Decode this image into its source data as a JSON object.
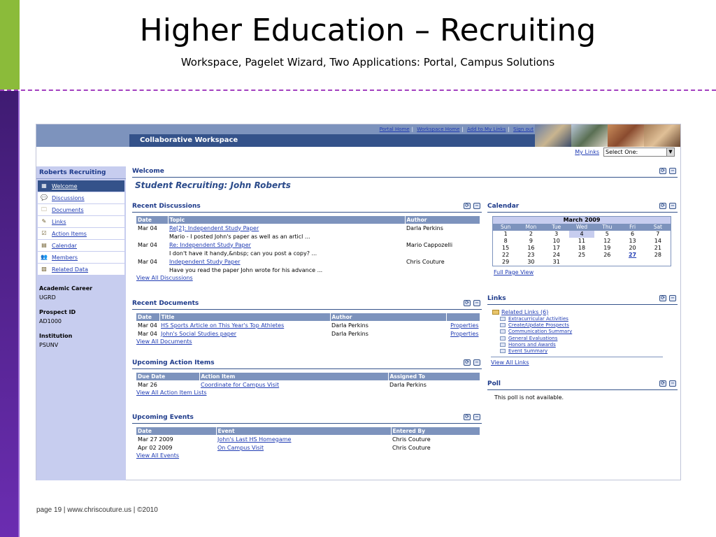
{
  "slide": {
    "title": "Higher Education – Recruiting",
    "subtitle": "Workspace, Pagelet Wizard, Two Applications: Portal, Campus Solutions",
    "footer": "page 19 | www.chriscouture.us | ©2010"
  },
  "app": {
    "top_links": [
      "Portal Home",
      "Workspace Home",
      "Add to My Links",
      "Sign out"
    ],
    "banner_title": "Collaborative Workspace",
    "my_links_label": "My Links",
    "select_value": "Select One:",
    "sidebar": {
      "title": "Roberts Recruiting",
      "items": [
        {
          "label": "Welcome",
          "icon": "grid-icon",
          "glyph": "▦"
        },
        {
          "label": "Discussions",
          "icon": "speech-bubble-icon",
          "glyph": "💬"
        },
        {
          "label": "Documents",
          "icon": "folder-docs-icon",
          "glyph": "🗀"
        },
        {
          "label": "Links",
          "icon": "link-icon",
          "glyph": "✎"
        },
        {
          "label": "Action Items",
          "icon": "checklist-icon",
          "glyph": "☑"
        },
        {
          "label": "Calendar",
          "icon": "calendar-icon",
          "glyph": "▤"
        },
        {
          "label": "Members",
          "icon": "members-icon",
          "glyph": "👥"
        },
        {
          "label": "Related Data",
          "icon": "related-data-icon",
          "glyph": "▧"
        }
      ],
      "info": [
        {
          "label": "Academic Career",
          "value": "UGRD"
        },
        {
          "label": "Prospect ID",
          "value": "AD1000"
        },
        {
          "label": "Institution",
          "value": "PSUNV"
        }
      ]
    },
    "welcome": {
      "header": "Welcome",
      "student_title": "Student Recruiting: John Roberts"
    },
    "discussions": {
      "header": "Recent Discussions",
      "columns": [
        "Date",
        "Topic",
        "Author"
      ],
      "rows": [
        {
          "date": "Mar 04",
          "topic": "Re[2]: Independent Study Paper",
          "preview": "Mario - I posted John's paper as well as an articl ...",
          "author": "Darla Perkins"
        },
        {
          "date": "Mar 04",
          "topic": "Re: Independent Study Paper",
          "preview": "I don't have it handy,&nbsp; can you post a copy? ...",
          "author": "Mario Cappozelli"
        },
        {
          "date": "Mar 04",
          "topic": "Independent Study Paper",
          "preview": "Have you read the paper John wrote for his advance ...",
          "author": "Chris Couture"
        }
      ],
      "view_all": "View All Discussions"
    },
    "documents": {
      "header": "Recent Documents",
      "columns": [
        "Date",
        "Title",
        "Author",
        ""
      ],
      "rows": [
        {
          "date": "Mar 04",
          "title": "HS Sports Article on This Year's Top Athletes",
          "author": "Darla Perkins",
          "action": "Properties"
        },
        {
          "date": "Mar 04",
          "title": "John's Social Studies paper",
          "author": "Darla Perkins",
          "action": "Properties"
        }
      ],
      "view_all": "View All Documents"
    },
    "action_items": {
      "header": "Upcoming Action Items",
      "columns": [
        "Due Date",
        "Action Item",
        "Assigned To"
      ],
      "rows": [
        {
          "due": "Mar 26",
          "item": "Coordinate for Campus Visit",
          "assigned": "Darla Perkins"
        }
      ],
      "view_all": "View All Action Item Lists"
    },
    "events": {
      "header": "Upcoming Events",
      "columns": [
        "Date",
        "Event",
        "Entered By"
      ],
      "rows": [
        {
          "date": "Mar 27 2009",
          "event": "John's Last HS Homegame",
          "entered": "Chris Couture"
        },
        {
          "date": "Apr 02 2009",
          "event": "On Campus Visit",
          "entered": "Chris Couture"
        }
      ],
      "view_all": "View All Events"
    },
    "calendar": {
      "header": "Calendar",
      "month": "March 2009",
      "day_names": [
        "Sun",
        "Mon",
        "Tue",
        "Wed",
        "Thu",
        "Fri",
        "Sat"
      ],
      "days": [
        "1",
        "2",
        "3",
        "4",
        "5",
        "6",
        "7",
        "8",
        "9",
        "10",
        "11",
        "12",
        "13",
        "14",
        "15",
        "16",
        "17",
        "18",
        "19",
        "20",
        "21",
        "22",
        "23",
        "24",
        "25",
        "26",
        "27",
        "28",
        "29",
        "30",
        "31"
      ],
      "today": "4",
      "linked_day": "27",
      "full_page_view": "Full Page View"
    },
    "links": {
      "header": "Links",
      "folder": "Related Links (6)",
      "items": [
        "Extracurricular Activities",
        "Create/Update Prospects",
        "Communication Summary",
        "General Evaluations",
        "Honors and Awards",
        "Event Summary"
      ],
      "view_all": "View All Links"
    },
    "poll": {
      "header": "Poll",
      "message": "This poll is not available."
    },
    "pagelet_icons": {
      "refresh": "⟳",
      "minimize": "−"
    }
  }
}
